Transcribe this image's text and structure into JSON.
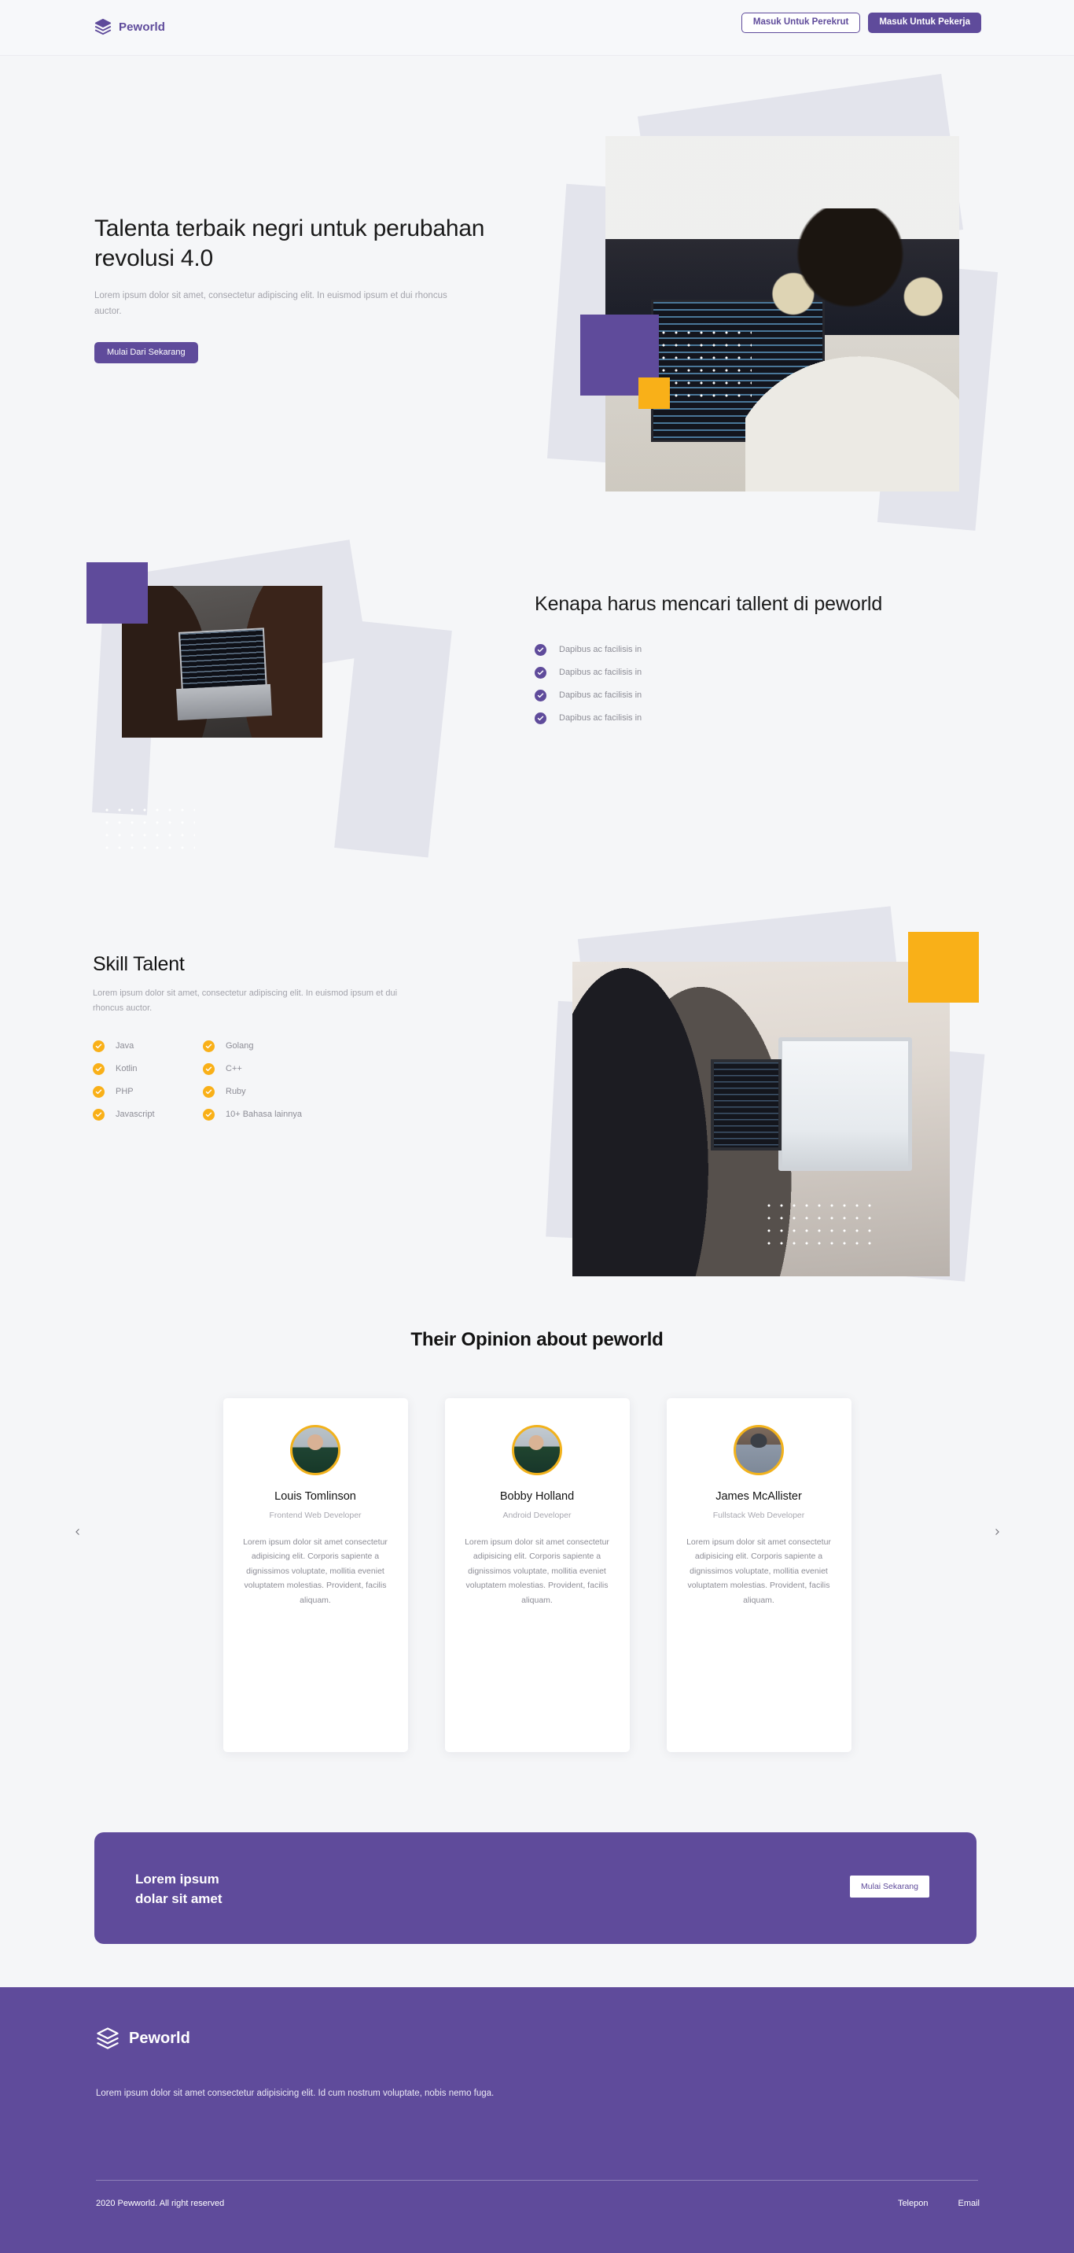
{
  "brand": {
    "name": "Peworld",
    "icon": "layers-icon",
    "color": "#5f4b9b"
  },
  "navbar": {
    "recruiter_login_label": "Masuk Untuk Perekrut",
    "worker_login_label": "Masuk Untuk Pekerja"
  },
  "hero": {
    "heading": "Talenta terbaik negri untuk perubahan revolusi 4.0",
    "paragraph": "Lorem ipsum dolor sit amet, consectetur adipiscing elit. In euismod ipsum et dui rhoncus auctor.",
    "cta_label": "Mulai Dari Sekarang",
    "image_alt": "developer-with-headphones-at-monitors-photo"
  },
  "why": {
    "heading": "Kenapa harus mencari tallent di peworld",
    "image_alt": "two-women-reviewing-code-on-laptop-photo",
    "items": [
      {
        "label": "Dapibus ac facilisis in"
      },
      {
        "label": "Dapibus ac facilisis in"
      },
      {
        "label": "Dapibus ac facilisis in"
      },
      {
        "label": "Dapibus ac facilisis in"
      }
    ]
  },
  "skill": {
    "heading": "Skill Talent",
    "paragraph": "Lorem ipsum dolor sit amet, consectetur adipiscing elit. In euismod ipsum et dui rhoncus auctor.",
    "image_alt": "team-working-at-desktop-computers-photo",
    "items": [
      {
        "label": "Java"
      },
      {
        "label": "Golang"
      },
      {
        "label": "Kotlin"
      },
      {
        "label": "C++"
      },
      {
        "label": "PHP"
      },
      {
        "label": "Ruby"
      },
      {
        "label": "Javascript"
      },
      {
        "label": "10+ Bahasa lainnya"
      }
    ]
  },
  "testimonials": {
    "title": "Their Opinion about peworld",
    "prev_label": "previous",
    "next_label": "next",
    "cards": [
      {
        "name": "Louis Tomlinson",
        "role": "Frontend Web Developer",
        "quote": "Lorem ipsum dolor sit amet consectetur adipisicing elit. Corporis sapiente a dignissimos voluptate, mollitia eveniet voluptatem molestias. Provident, facilis aliquam."
      },
      {
        "name": "Bobby Holland",
        "role": "Android Developer",
        "quote": "Lorem ipsum dolor sit amet consectetur adipisicing elit. Corporis sapiente a dignissimos voluptate, mollitia eveniet voluptatem molestias. Provident, facilis aliquam."
      },
      {
        "name": "James McAllister",
        "role": "Fullstack Web Developer",
        "quote": "Lorem ipsum dolor sit amet consectetur adipisicing elit. Corporis sapiente a dignissimos voluptate, mollitia eveniet voluptatem molestias. Provident, facilis aliquam."
      }
    ]
  },
  "cta_band": {
    "line1": "Lorem ipsum",
    "line2": "dolar sit amet",
    "button_label": "Mulai Sekarang"
  },
  "footer": {
    "brand_name": "Peworld",
    "description": "Lorem ipsum dolor sit amet consectetur adipisicing elit. Id cum nostrum voluptate, nobis nemo fuga.",
    "copyright": "2020 Pewworld. All right reserved",
    "links": [
      {
        "label": "Telepon"
      },
      {
        "label": "Email"
      }
    ]
  },
  "colors": {
    "purple": "#5f4b9b",
    "yellow": "#f9b018",
    "page_bg": "#f5f6f8",
    "slab": "#e3e4ec"
  }
}
